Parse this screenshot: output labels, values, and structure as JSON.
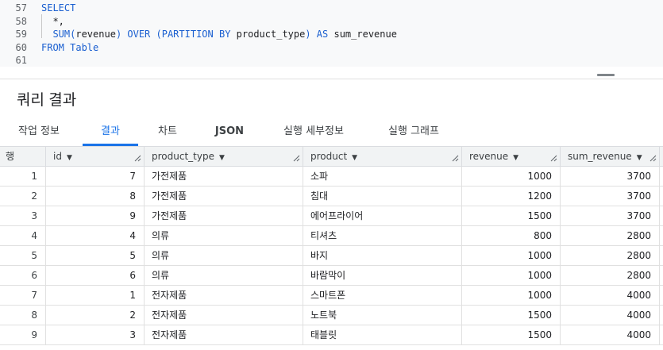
{
  "editor": {
    "lines": [
      {
        "num": "57",
        "tokens": [
          {
            "t": "SELECT",
            "k": "kw"
          }
        ]
      },
      {
        "num": "58",
        "tokens": [
          {
            "t": "  *,",
            "k": "id"
          }
        ]
      },
      {
        "num": "59",
        "tokens": [
          {
            "t": "  SUM(",
            "k": "kw"
          },
          {
            "t": "revenue",
            "k": "id"
          },
          {
            "t": ") OVER (PARTITION BY ",
            "k": "kw"
          },
          {
            "t": "product_type",
            "k": "id"
          },
          {
            "t": ") AS ",
            "k": "kw"
          },
          {
            "t": "sum_revenue",
            "k": "id"
          }
        ]
      },
      {
        "num": "60",
        "tokens": [
          {
            "t": "FROM ",
            "k": "kw"
          },
          {
            "t": "Table",
            "k": "kw"
          }
        ]
      },
      {
        "num": "61",
        "tokens": []
      }
    ]
  },
  "results": {
    "title": "쿼리 결과"
  },
  "tabs": [
    {
      "label": "작업 정보",
      "active": false
    },
    {
      "label": "결과",
      "active": true
    },
    {
      "label": "차트",
      "active": false
    },
    {
      "label": "JSON",
      "active": false
    },
    {
      "label": "실행 세부정보",
      "active": false
    },
    {
      "label": "실행 그래프",
      "active": false
    }
  ],
  "table": {
    "row_header": "행",
    "columns": [
      "id",
      "product_type",
      "product",
      "revenue",
      "sum_revenue"
    ],
    "rows": [
      {
        "n": "1",
        "id": "7",
        "product_type": "가전제품",
        "product": "소파",
        "revenue": "1000",
        "sum_revenue": "3700"
      },
      {
        "n": "2",
        "id": "8",
        "product_type": "가전제품",
        "product": "침대",
        "revenue": "1200",
        "sum_revenue": "3700"
      },
      {
        "n": "3",
        "id": "9",
        "product_type": "가전제품",
        "product": "에어프라이어",
        "revenue": "1500",
        "sum_revenue": "3700"
      },
      {
        "n": "4",
        "id": "4",
        "product_type": "의류",
        "product": "티셔츠",
        "revenue": "800",
        "sum_revenue": "2800"
      },
      {
        "n": "5",
        "id": "5",
        "product_type": "의류",
        "product": "바지",
        "revenue": "1000",
        "sum_revenue": "2800"
      },
      {
        "n": "6",
        "id": "6",
        "product_type": "의류",
        "product": "바람막이",
        "revenue": "1000",
        "sum_revenue": "2800"
      },
      {
        "n": "7",
        "id": "1",
        "product_type": "전자제품",
        "product": "스마트폰",
        "revenue": "1000",
        "sum_revenue": "4000"
      },
      {
        "n": "8",
        "id": "2",
        "product_type": "전자제품",
        "product": "노트북",
        "revenue": "1500",
        "sum_revenue": "4000"
      },
      {
        "n": "9",
        "id": "3",
        "product_type": "전자제품",
        "product": "태블릿",
        "revenue": "1500",
        "sum_revenue": "4000"
      }
    ]
  },
  "icons": {
    "sort": "sort-down-arrow-icon",
    "resize": "column-resize-handle-icon"
  }
}
